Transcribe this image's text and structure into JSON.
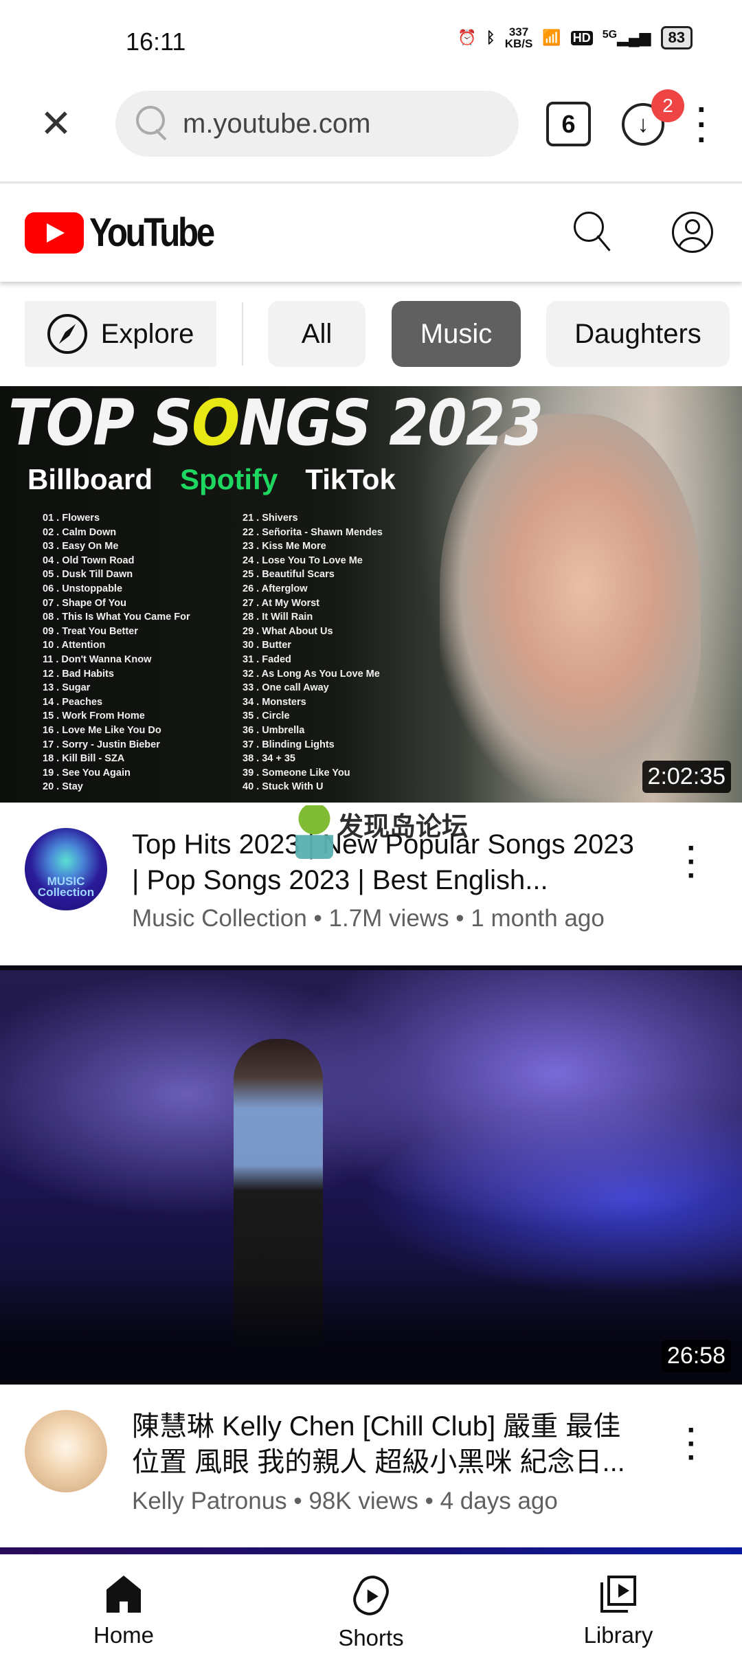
{
  "status_bar": {
    "time": "16:11",
    "net_speed": "337",
    "net_speed_unit": "KB/S",
    "hd": "HD",
    "network": "5G",
    "battery": "83"
  },
  "browser": {
    "url": "m.youtube.com",
    "tab_count": "6",
    "download_badge": "2"
  },
  "youtube": {
    "logo_text": "YouTube",
    "chips": [
      {
        "label": "Explore",
        "icon": "compass-icon"
      },
      {
        "label": "All"
      },
      {
        "label": "Music",
        "selected": true
      },
      {
        "label": "Daughters"
      }
    ],
    "videos": [
      {
        "thumbnail": {
          "title_a": "TOP S",
          "title_o": "O",
          "title_b": "NGS 2023",
          "brands": [
            "Billboard",
            "Spotify",
            "TikTok"
          ],
          "songs_left": [
            "01 . Flowers",
            "02 . Calm Down",
            "03 . Easy On Me",
            "04 . Old Town Road",
            "05 . Dusk Till Dawn",
            "06 . Unstoppable",
            "07 . Shape Of You",
            "08 . This Is What You Came For",
            "09 . Treat You Better",
            "10 . Attention",
            "11 . Don't Wanna Know",
            "12 . Bad Habits",
            "13 . Sugar",
            "14 . Peaches",
            "15 . Work From Home",
            "16 . Love Me Like You Do",
            "17 . Sorry - Justin Bieber",
            "18 . Kill Bill - SZA",
            "19 . See You Again",
            "20 . Stay"
          ],
          "songs_right": [
            "21 . Shivers",
            "22 . Señorita - Shawn Mendes",
            "23 . Kiss Me More",
            "24 . Lose You To Love Me",
            "25 . Beautiful Scars",
            "26 . Afterglow",
            "27 . At My Worst",
            "28 . It Will Rain",
            "29 . What About Us",
            "30 . Butter",
            "31 . Faded",
            "32 . As Long As You Love Me",
            "33 . One call Away",
            "34 . Monsters",
            "35 . Circle",
            "36 . Umbrella",
            "37 . Blinding Lights",
            "38 . 34 + 35",
            "39 . Someone Like You",
            "40 . Stuck With U"
          ]
        },
        "duration": "2:02:35",
        "avatar_text": "MUSIC Collection",
        "title": "Top Hits 2023 | New Popular Songs 2023 | Pop Songs 2023 | Best English...",
        "channel": "Music Collection",
        "views": "1.7M views",
        "age": "1 month ago"
      },
      {
        "duration": "26:58",
        "title": "陳慧琳 Kelly Chen [Chill Club] 嚴重 最佳 位置 風眼 我的親人 超級小黑咪 紀念日...",
        "channel": "Kelly Patronus",
        "views": "98K views",
        "age": "4 days ago"
      }
    ],
    "separator": " • ",
    "bottom_nav": [
      {
        "label": "Home",
        "active": true
      },
      {
        "label": "Shorts"
      },
      {
        "label": "Library"
      }
    ]
  },
  "watermark": {
    "text": "发现岛论坛"
  },
  "colors": {
    "brand_red": "#ff0000",
    "chip_selected": "#606060",
    "badge_red": "#ef4444",
    "meta_gray": "#606060"
  }
}
